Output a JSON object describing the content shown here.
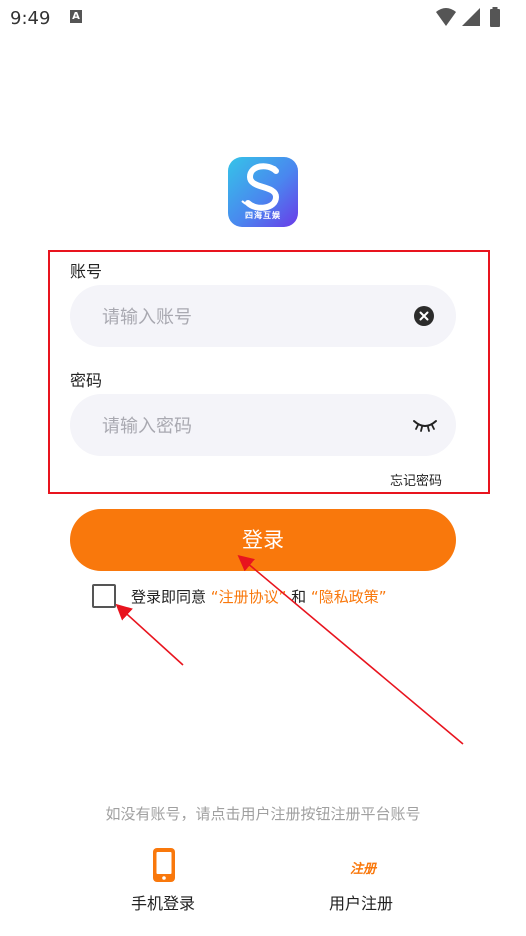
{
  "status": {
    "time": "9:49",
    "notif_letter": "A"
  },
  "logo": {
    "text": "四海互娱"
  },
  "account": {
    "label": "账号",
    "placeholder": "请输入账号"
  },
  "password": {
    "label": "密码",
    "placeholder": "请输入密码"
  },
  "forgot_label": "忘记密码",
  "login_label": "登录",
  "agreement": {
    "prefix": "登录即同意",
    "link1": "“注册协议”",
    "middle": "和",
    "link2": "“隐私政策”"
  },
  "hint": "如没有账号，请点击用户注册按钮注册平台账号",
  "bottom": {
    "phone_label": "手机登录",
    "register_icon_text": "注册",
    "register_label": "用户注册"
  },
  "colors": {
    "accent": "#f9780c",
    "annotation": "#e8141e",
    "field_bg": "#f4f4f9"
  },
  "icons": [
    "wifi-icon",
    "signal-icon",
    "battery-icon",
    "clear-icon",
    "eye-closed-icon",
    "phone-icon",
    "register-icon"
  ]
}
